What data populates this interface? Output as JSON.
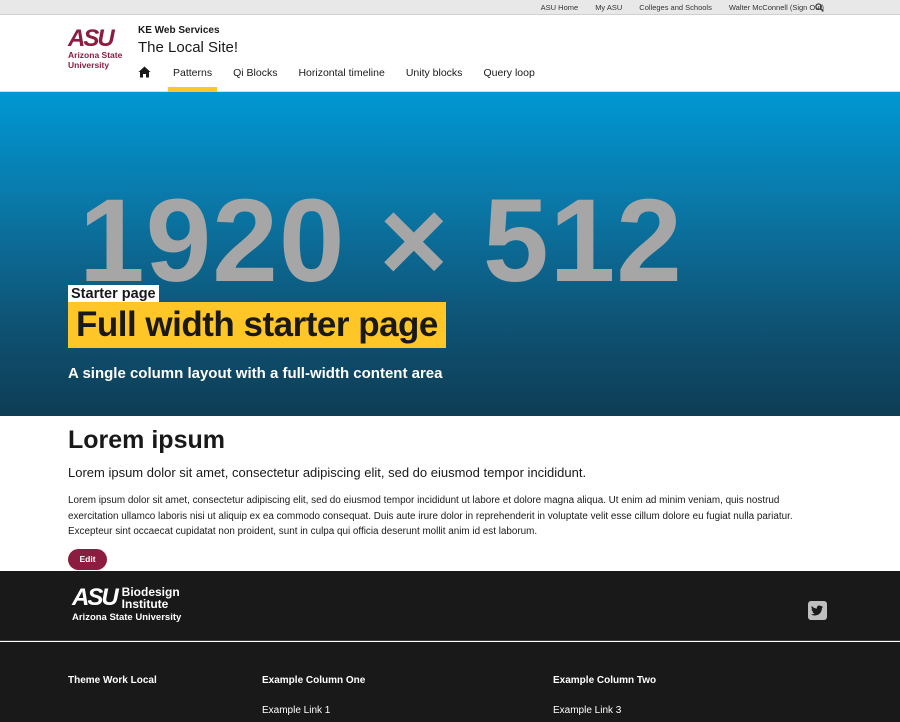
{
  "utility": {
    "links": [
      "ASU Home",
      "My ASU",
      "Colleges and Schools",
      "Walter McConnell (Sign Out)"
    ]
  },
  "header": {
    "logo": {
      "mark": "ASU",
      "name_line1": "Arizona State",
      "name_line2": "University"
    },
    "parent_unit": "KE Web Services",
    "site_title": "The Local Site!",
    "nav": [
      "Patterns",
      "Qi Blocks",
      "Horizontal timeline",
      "Unity blocks",
      "Query loop"
    ],
    "active_nav": "Patterns"
  },
  "hero": {
    "placeholder_text": "1920 × 512",
    "eyebrow": "Starter page",
    "title": "Full width starter page",
    "subtitle": "A single column layout with a full-width content area"
  },
  "content": {
    "heading": "Lorem ipsum",
    "lead": "Lorem ipsum dolor sit amet, consectetur adipiscing elit, sed do eiusmod tempor incididunt.",
    "body": "Lorem ipsum dolor sit amet, consectetur adipiscing elit, sed do eiusmod tempor incididunt ut labore et dolore magna aliqua. Ut enim ad minim veniam, quis nostrud exercitation ullamco laboris nisi ut aliquip ex ea commodo consequat. Duis aute irure dolor in reprehenderit in voluptate velit esse cillum dolore eu fugiat nulla pariatur. Excepteur sint occaecat cupidatat non proident, sunt in culpa qui officia deserunt mollit anim id est laborum.",
    "edit_label": "Edit"
  },
  "footer": {
    "logo": {
      "mark": "ASU",
      "unit_line1": "Biodesign",
      "unit_line2": "Institute",
      "university": "Arizona State University"
    },
    "columns": [
      {
        "title": "Theme Work Local",
        "links": []
      },
      {
        "title": "Example Column One",
        "links": [
          "Example Link 1"
        ]
      },
      {
        "title": "Example Column Two",
        "links": [
          "Example Link 3"
        ]
      }
    ]
  },
  "colors": {
    "maroon": "#8c1d40",
    "gold": "#ffc627",
    "hero_top": "#0098d4",
    "hero_bottom": "#0e3d55",
    "footer_bg": "#191919"
  },
  "icons": [
    "search-icon",
    "home-icon",
    "twitter-icon"
  ]
}
